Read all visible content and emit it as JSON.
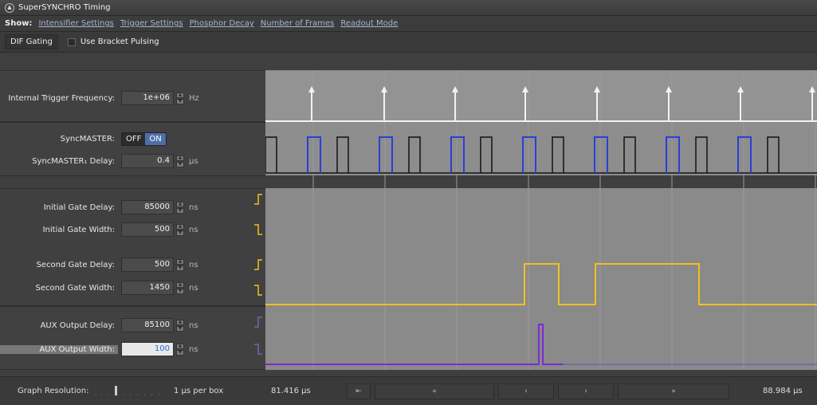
{
  "window": {
    "title": "SuperSYNCHRO Timing"
  },
  "show": {
    "label": "Show:",
    "links": [
      "Intensifier Settings",
      "Trigger Settings",
      "Phosphor Decay",
      "Number of Frames",
      "Readout Mode"
    ]
  },
  "options": {
    "dif_gating": "DIF Gating",
    "bracket_pulsing": "Use Bracket Pulsing"
  },
  "trigger": {
    "label": "Internal Trigger Frequency:",
    "value": "1e+06",
    "unit": "Hz"
  },
  "syncmaster": {
    "label": "SyncMASTER:",
    "off": "OFF",
    "on": "ON",
    "state": "ON",
    "delay_label": "SyncMASTER₁ Delay:",
    "delay_value": "0.4",
    "delay_unit": "µs"
  },
  "gates": {
    "initial_delay_label": "Initial Gate Delay:",
    "initial_delay_value": "85000",
    "initial_delay_unit": "ns",
    "initial_width_label": "Initial Gate Width:",
    "initial_width_value": "500",
    "initial_width_unit": "ns",
    "second_delay_label": "Second Gate Delay:",
    "second_delay_value": "500",
    "second_delay_unit": "ns",
    "second_width_label": "Second Gate Width:",
    "second_width_value": "1450",
    "second_width_unit": "ns"
  },
  "aux": {
    "delay_label": "AUX Output Delay:",
    "delay_value": "85100",
    "delay_unit": "ns",
    "width_label": "AUX Output Width:",
    "width_value": "100",
    "width_unit": "ns"
  },
  "bottom": {
    "resolution_label": "Graph Resolution:",
    "resolution_value": "1 µs per box",
    "time_start": "81.416 µs",
    "time_end": "88.984 µs",
    "nav": [
      "⇤",
      "«",
      "‹",
      "›",
      "»"
    ]
  },
  "colors": {
    "trigger": "#f2f2f2",
    "sync_black": "#111111",
    "sync_blue": "#2a3fd6",
    "gate": "#f0c020",
    "aux": "#7a2ad8",
    "graph_bg": "#8a8a8a"
  }
}
